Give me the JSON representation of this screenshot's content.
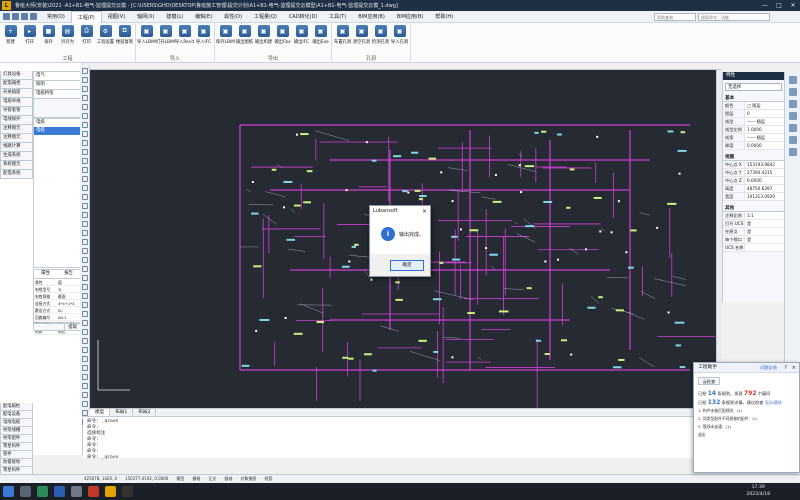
{
  "app": {
    "title": "鲁班大师(安装)2021 -A1+B1-电气-监理提交云模 - [C:\\USERS\\GHD\\DESKTOP\\鲁班施工管理\\提交计划\\A1+B1-电气-监理提交云模型\\A1+B1-电气-监理提交云模_1.dwg]",
    "logo": "L"
  },
  "window_controls": [
    "—",
    "□",
    "✕"
  ],
  "menu": {
    "items": [
      "常用(O)",
      "工程(P)",
      "视图(V)",
      "轴网(X)",
      "建模(L)",
      "编辑(E)",
      "属性(D)",
      "工程量(Q)",
      "CAD转化(D)",
      "工具(T)",
      "BIM应用(B)",
      "BIM应用(B)",
      "帮助(H)"
    ],
    "active_index": 1,
    "search_placeholder": "搜索命令、功能",
    "search2_placeholder": "帮助查询"
  },
  "ribbon": {
    "groups": [
      {
        "label": "工程",
        "tools": [
          "新建",
          "打开",
          "保存",
          "另存为",
          "打印",
          "工程设置",
          "楼层复制"
        ]
      },
      {
        "label": "导入",
        "tools": [
          "导入LBIM",
          "打开LBIM",
          "导入Revit",
          "导入IFC"
        ]
      },
      {
        "label": "导出",
        "tools": [
          "保存LBIM",
          "输出图纸",
          "输出构建",
          "输出Fbx",
          "输出IFC",
          "输出Exe"
        ]
      },
      {
        "label": "孔洞",
        "tools": [
          "布置孔洞",
          "清空孔洞",
          "检测孔洞",
          "导入孔洞"
        ]
      }
    ]
  },
  "left_panel": {
    "tabs": [
      "灯具设备",
      "配电箱柜",
      "开关插座",
      "电缆导线",
      "导管套管",
      "电线保护",
      "注释图元",
      "注释图元",
      "线路计算",
      "生成系统",
      "系统图元",
      "配电系统"
    ],
    "header_selects": [
      "电气",
      "照明",
      "电缆桥架"
    ],
    "list_header": "电缆",
    "list_items": [
      "电缆"
    ],
    "list_selected": 0,
    "props_tabs": [
      "属性",
      "报告"
    ],
    "props_rows": [
      [
        "属性",
        "值"
      ],
      [
        "电缆型号",
        "YJ"
      ],
      [
        "电缆规格",
        "截面"
      ],
      [
        "连接方式",
        "4*4+1*4"
      ],
      [
        "敷设方式",
        "SC"
      ],
      [
        "回路编号",
        "WL1"
      ],
      [
        "系统类型",
        "动力电缆"
      ],
      [
        "材质",
        "铜芯"
      ]
    ],
    "bottom": {
      "left": "",
      "button": "提取"
    },
    "lower_tabs": [
      "配电箱柜",
      "配电设备",
      "电线电缆",
      "桥架线槽",
      "桥架配件",
      "零星构件",
      "管件",
      "防雷接地",
      "零星构件",
      "自定义构件",
      "自定义设备"
    ]
  },
  "layout_tabs": [
    "模型",
    "布局1",
    "布局2"
  ],
  "layout_active": 0,
  "command_lines": [
    "命令: _qsave",
    "命令:",
    "选择标注",
    "命令:",
    "命令:",
    "命令:",
    "命令: _qsave"
  ],
  "status_bar": [
    "425078, 1420, 0 ",
    "150377.4192, 0.0000",
    "模型",
    "栅格",
    "正交",
    "极轴",
    "对象捕捉",
    "线宽"
  ],
  "properties": {
    "title": "特性",
    "selector": "无选择",
    "sections": [
      {
        "name": "基本",
        "rows": [
          [
            "颜色",
            "□ 随层"
          ],
          [
            "图层",
            "0"
          ],
          [
            "线型",
            "—— 随层"
          ],
          [
            "线型比例",
            "1.0000"
          ],
          [
            "线宽",
            "—— 随层"
          ],
          [
            "厚度",
            "0.0000"
          ]
        ]
      },
      {
        "name": "视图",
        "rows": [
          [
            "中心点 X",
            "153193.9842"
          ],
          [
            "中心点 Y",
            "27394.4215"
          ],
          [
            "中心点 Z",
            "0.0000"
          ],
          [
            "高度",
            "48750.6397"
          ],
          [
            "宽度",
            "101313.0929"
          ]
        ]
      },
      {
        "name": "其他",
        "rows": [
          [
            "注释比例",
            "1:1"
          ],
          [
            "打开 UCS",
            "是"
          ],
          [
            "在原点",
            "是"
          ],
          [
            "每个视口",
            "是"
          ],
          [
            "UCS 名称",
            ""
          ]
        ]
      }
    ]
  },
  "dialog": {
    "title": "Lubansoft",
    "close": "×",
    "icon": "i",
    "message": "输出完成。",
    "ok": "确定"
  },
  "assistant": {
    "title": "工程助手",
    "link": "问题反馈",
    "help": "?",
    "close": "×",
    "tab": "云检查",
    "line1_prefix": "已检",
    "line1_count": "14",
    "line1_mid": "条规则，发现",
    "line1_issues": "792",
    "line1_suffix": "个疑问",
    "line2_prefix": "已检",
    "line2_count": "132",
    "line2_mid": "条规则详情，建议检查",
    "line2_link": "显示规则",
    "items": [
      "1. 构件未被匹配规则：(1)",
      "2. 同类型配件不同规格的配件：(1)",
      "3. 管线未连通：(1)"
    ],
    "footer": "退出"
  },
  "taskbar": {
    "time": "17:39",
    "date": "2022/4/18"
  }
}
